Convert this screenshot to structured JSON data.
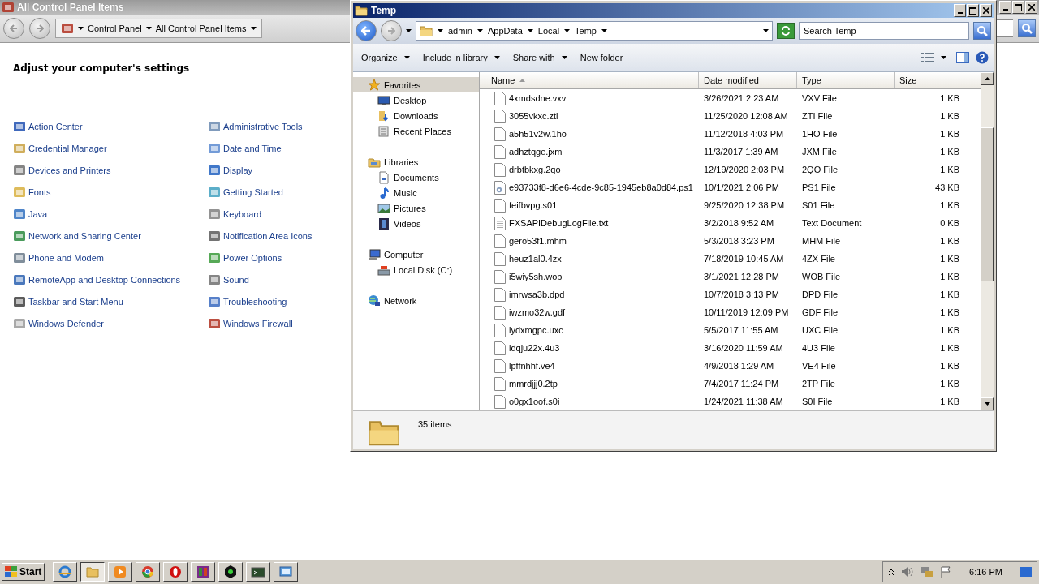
{
  "control_panel": {
    "title": "All Control Panel Items",
    "breadcrumb": [
      "Control Panel",
      "All Control Panel Items"
    ],
    "heading": "Adjust your computer's settings",
    "items": [
      {
        "label": "Action Center"
      },
      {
        "label": "Administrative Tools"
      },
      {
        "label": "Credential Manager"
      },
      {
        "label": "Date and Time"
      },
      {
        "label": "Devices and Printers"
      },
      {
        "label": "Display"
      },
      {
        "label": "Fonts"
      },
      {
        "label": "Getting Started"
      },
      {
        "label": "Java"
      },
      {
        "label": "Keyboard"
      },
      {
        "label": "Network and Sharing Center"
      },
      {
        "label": "Notification Area Icons"
      },
      {
        "label": "Phone and Modem"
      },
      {
        "label": "Power Options"
      },
      {
        "label": "RemoteApp and Desktop Connections"
      },
      {
        "label": "Sound"
      },
      {
        "label": "Taskbar and Start Menu"
      },
      {
        "label": "Troubleshooting"
      },
      {
        "label": "Windows Defender"
      },
      {
        "label": "Windows Firewall"
      }
    ]
  },
  "explorer": {
    "title": "Temp",
    "breadcrumb": [
      "admin",
      "AppData",
      "Local",
      "Temp"
    ],
    "search": {
      "placeholder": "Search Temp"
    },
    "toolbar": [
      {
        "label": "Organize",
        "dropdown": true
      },
      {
        "label": "Include in library",
        "dropdown": true
      },
      {
        "label": "Share with",
        "dropdown": true
      },
      {
        "label": "New folder",
        "dropdown": false
      }
    ],
    "navigation": [
      {
        "label": "Favorites",
        "kind": "star",
        "selected": true,
        "children": [
          {
            "label": "Desktop",
            "kind": "desktop",
            "selected": false
          },
          {
            "label": "Downloads",
            "kind": "downloads",
            "selected": false
          },
          {
            "label": "Recent Places",
            "kind": "recent",
            "selected": false
          }
        ]
      },
      {
        "label": "Libraries",
        "kind": "library",
        "selected": false,
        "children": [
          {
            "label": "Documents",
            "kind": "document",
            "selected": false
          },
          {
            "label": "Music",
            "kind": "music",
            "selected": false
          },
          {
            "label": "Pictures",
            "kind": "pictures",
            "selected": false
          },
          {
            "label": "Videos",
            "kind": "videos",
            "selected": false
          }
        ]
      },
      {
        "label": "Computer",
        "kind": "computer",
        "selected": false,
        "children": [
          {
            "label": "Local Disk (C:)",
            "kind": "disk",
            "selected": false
          }
        ]
      },
      {
        "label": "Network",
        "kind": "network",
        "selected": false
      }
    ],
    "columns": [
      {
        "label": "Name",
        "sorted": true
      },
      {
        "label": "Date modified",
        "sorted": false
      },
      {
        "label": "Type",
        "sorted": false
      },
      {
        "label": "Size",
        "sorted": false
      }
    ],
    "rows": [
      {
        "name": "4xmdsdne.vxv",
        "date": "3/26/2021 2:23 AM",
        "type": "VXV File",
        "size": "1 KB",
        "kind": "file"
      },
      {
        "name": "3055vkxc.zti",
        "date": "11/25/2020 12:08 AM",
        "type": "ZTI File",
        "size": "1 KB",
        "kind": "file"
      },
      {
        "name": "a5h51v2w.1ho",
        "date": "11/12/2018 4:03 PM",
        "type": "1HO File",
        "size": "1 KB",
        "kind": "file"
      },
      {
        "name": "adhztqge.jxm",
        "date": "11/3/2017 1:39 AM",
        "type": "JXM File",
        "size": "1 KB",
        "kind": "file"
      },
      {
        "name": "drbtbkxg.2qo",
        "date": "12/19/2020 2:03 PM",
        "type": "2QO File",
        "size": "1 KB",
        "kind": "file"
      },
      {
        "name": "e93733f8-d6e6-4cde-9c85-1945eb8a0d84.ps1",
        "date": "10/1/2021 2:06 PM",
        "type": "PS1 File",
        "size": "43 KB",
        "kind": "script"
      },
      {
        "name": "feifbvpg.s01",
        "date": "9/25/2020 12:38 PM",
        "type": "S01 File",
        "size": "1 KB",
        "kind": "file"
      },
      {
        "name": "FXSAPIDebugLogFile.txt",
        "date": "3/2/2018 9:52 AM",
        "type": "Text Document",
        "size": "0 KB",
        "kind": "text"
      },
      {
        "name": "gero53f1.mhm",
        "date": "5/3/2018 3:23 PM",
        "type": "MHM File",
        "size": "1 KB",
        "kind": "file"
      },
      {
        "name": "heuz1al0.4zx",
        "date": "7/18/2019 10:45 AM",
        "type": "4ZX File",
        "size": "1 KB",
        "kind": "file"
      },
      {
        "name": "i5wiy5sh.wob",
        "date": "3/1/2021 12:28 PM",
        "type": "WOB File",
        "size": "1 KB",
        "kind": "file"
      },
      {
        "name": "imrwsa3b.dpd",
        "date": "10/7/2018 3:13 PM",
        "type": "DPD File",
        "size": "1 KB",
        "kind": "file"
      },
      {
        "name": "iwzmo32w.gdf",
        "date": "10/11/2019 12:09 PM",
        "type": "GDF File",
        "size": "1 KB",
        "kind": "file"
      },
      {
        "name": "iydxmgpc.uxc",
        "date": "5/5/2017 11:55 AM",
        "type": "UXC File",
        "size": "1 KB",
        "kind": "file"
      },
      {
        "name": "ldqju22x.4u3",
        "date": "3/16/2020 11:59 AM",
        "type": "4U3 File",
        "size": "1 KB",
        "kind": "file"
      },
      {
        "name": "lpffnhhf.ve4",
        "date": "4/9/2018 1:29 AM",
        "type": "VE4 File",
        "size": "1 KB",
        "kind": "file"
      },
      {
        "name": "mmrdjjj0.2tp",
        "date": "7/4/2017 11:24 PM",
        "type": "2TP File",
        "size": "1 KB",
        "kind": "file"
      },
      {
        "name": "o0gx1oof.s0i",
        "date": "1/24/2021 11:38 AM",
        "type": "S0I File",
        "size": "1 KB",
        "kind": "file"
      }
    ],
    "status": "35 items"
  },
  "taskbar": {
    "start": "Start",
    "apps": [
      {
        "selected": false
      },
      {
        "selected": true
      },
      {
        "selected": false
      },
      {
        "selected": false
      },
      {
        "selected": false
      },
      {
        "selected": false
      },
      {
        "selected": false
      },
      {
        "selected": false
      },
      {
        "selected": false
      }
    ],
    "tray": {
      "clock": "6:16 PM"
    }
  }
}
